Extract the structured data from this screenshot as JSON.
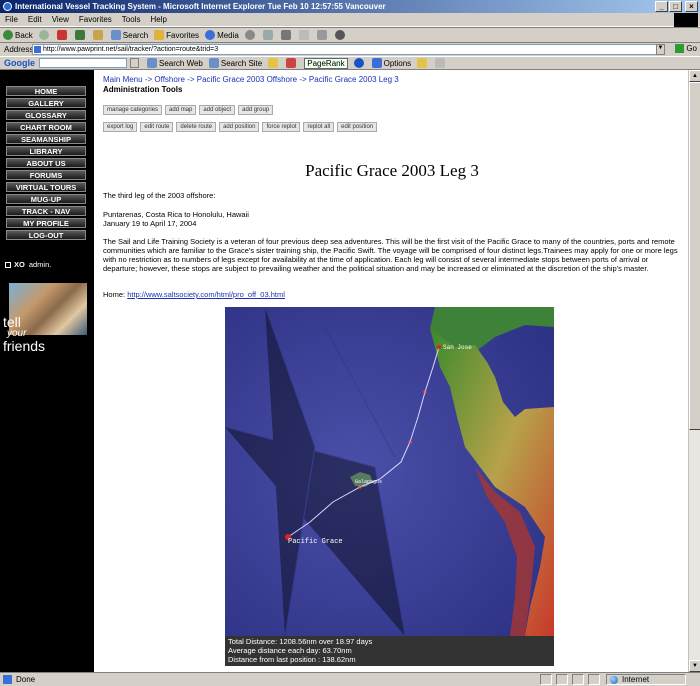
{
  "window": {
    "title": "International Vessel Tracking System - Microsoft Internet Explorer   Tue Feb 10 12:57:55 Vancouver"
  },
  "menu": [
    "File",
    "Edit",
    "View",
    "Favorites",
    "Tools",
    "Help"
  ],
  "toolbar": {
    "back": "Back",
    "search": "Search",
    "favorites": "Favorites",
    "media": "Media"
  },
  "address": {
    "label": "Address",
    "url": "http://www.pawprint.net/sail/tracker/?action=route&trid=3",
    "go": "Go"
  },
  "google_bar": {
    "logo": "Google",
    "search_web": "Search Web",
    "search_site": "Search Site",
    "pagerank": "PageRank",
    "options": "Options"
  },
  "sidebar": {
    "nav": [
      "HOME",
      "GALLERY",
      "GLOSSARY",
      "CHART ROOM",
      "SEAMANSHIP",
      "LIBRARY",
      "ABOUT US",
      "FORUMS",
      "VIRTUAL TOURS",
      "MUG-UP",
      "TRACK - NAV",
      "MY PROFILE",
      "LOG-OUT"
    ],
    "xo_label": "XO",
    "xo_role": "admin.",
    "ad_line1": "tell",
    "ad_line2": "your",
    "ad_line3": "friends"
  },
  "breadcrumb": {
    "items": [
      "Main Menu",
      "Offshore",
      "Pacific Grace 2003 Offshore",
      "Pacific Grace 2003 Leg 3"
    ],
    "separator": "->"
  },
  "admin": {
    "title": "Administration Tools",
    "row1": [
      "manage categories",
      "add map",
      "add object",
      "add group"
    ],
    "row2": [
      "export log",
      "edit route",
      "delete route",
      "add position",
      "force replot",
      "replot all",
      "edit position"
    ]
  },
  "content": {
    "heading": "Pacific Grace 2003 Leg 3",
    "intro": "The third leg of the 2003 offshore:",
    "route": "Puntarenas, Costa Rica to Honolulu, Hawaii",
    "dates": "January 19 to April 17, 2004",
    "body": "The Sail and Life Training Society is a veteran of four previous deep sea adventures. This will be the first visit of the Pacific Grace to many of the countries, ports and remote communities which are familiar to the Grace's sister training ship, the Pacific Swift. The voyage will be comprised of four distinct legs.Trainees may apply for one or more legs with no restriction as to numbers of legs except for availability at the time of application. Each leg will consist of several intermediate stops between ports of arrival or departure; however, these stops are subject to prevailing weather and the political situation and may be increased or eliminated at the discretion of the ship's master.",
    "home_label": "Home:",
    "home_link": "http://www.saltsociety.com/html/pro_off_03.html"
  },
  "map": {
    "label_start": "San Jose",
    "label_mid": "Galapagos",
    "label_ship": "Pacific Grace",
    "stats": [
      "Total Distance: 1208.56nm over 18.97 days",
      "Average distance each day: 63.70nm",
      "Distance from last position : 138.62nm"
    ]
  },
  "status": {
    "text": "Done",
    "zone": "Internet"
  }
}
